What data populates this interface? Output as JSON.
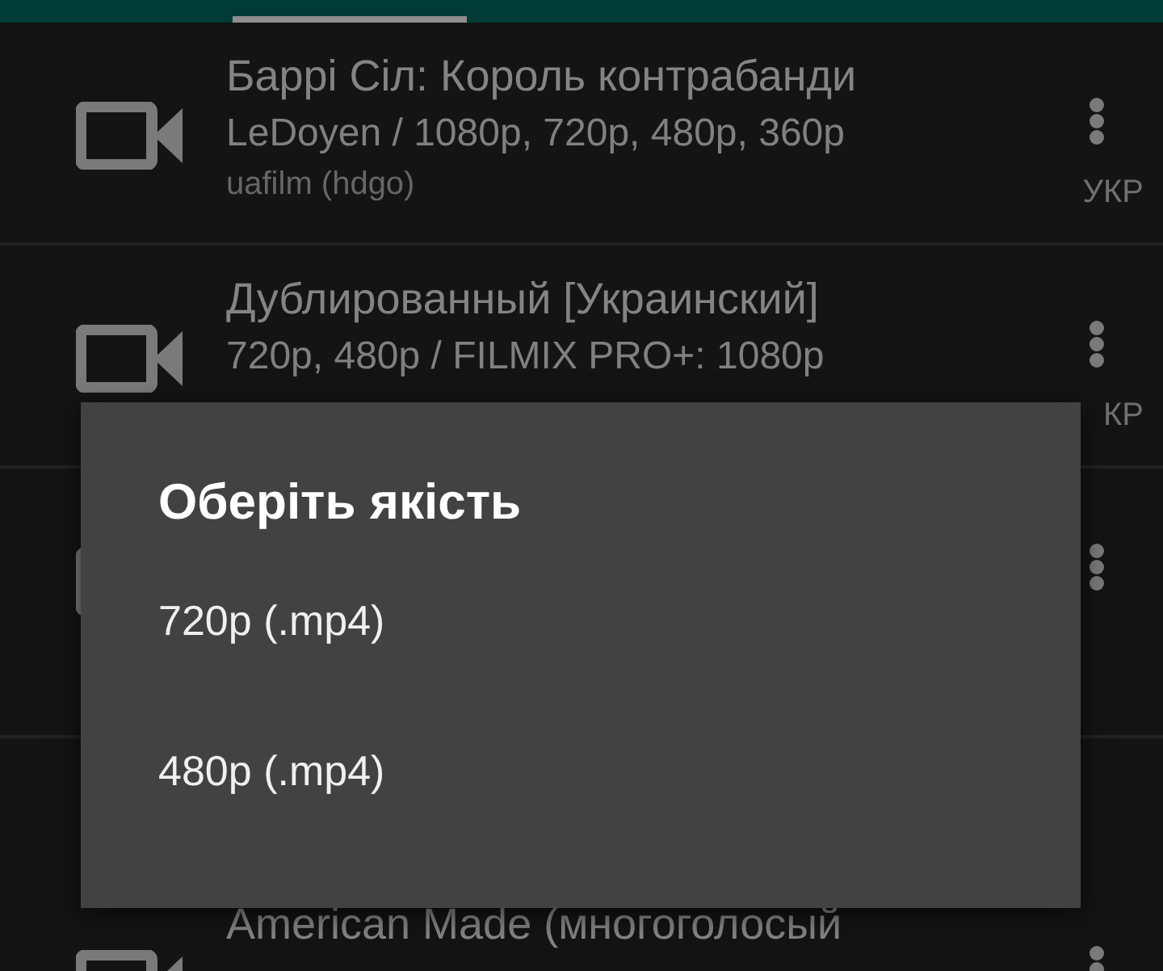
{
  "tabs": [
    {
      "selected": true
    }
  ],
  "items": [
    {
      "kind": "video",
      "title": "Баррі Сіл: Король контрабанди",
      "subtitle": "LeDoyen / 1080p, 720p, 480p, 360p",
      "source": "uafilm (hdgo)",
      "lang": "УКР"
    },
    {
      "kind": "video",
      "title": "Дублированный [Украинский]",
      "subtitle": "720p, 480p / FILMIX PRO+: 1080p",
      "lang": "КР"
    },
    {
      "kind": "video"
    },
    {
      "kind": "video",
      "title": "American Made (многоголосый"
    }
  ],
  "dialog": {
    "title": "Оберіть якість",
    "options": [
      "720p (.mp4)",
      "480p (.mp4)"
    ]
  }
}
